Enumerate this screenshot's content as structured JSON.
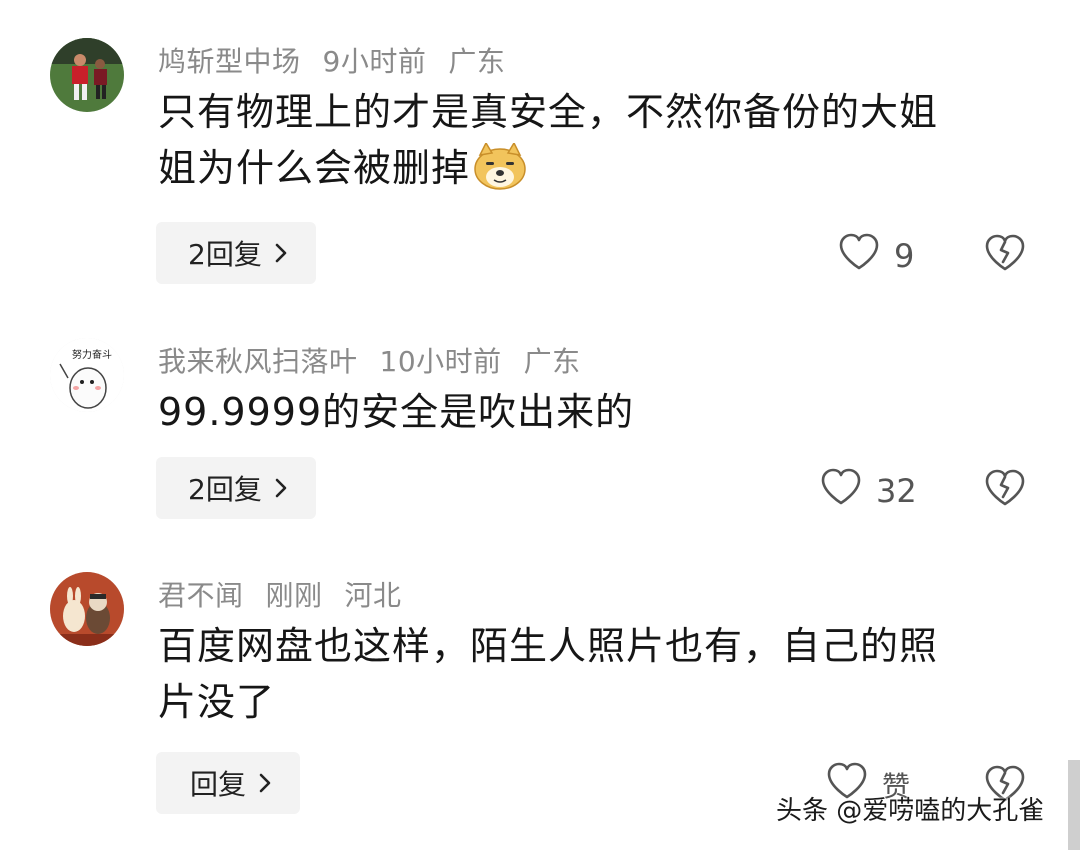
{
  "comments": [
    {
      "username": "鸠斩型中场",
      "time": "9小时前",
      "location": "广东",
      "text_line1": "只有物理上的才是真安全，不然你备份的大姐",
      "text_line2": "姐为什么会被删掉",
      "emoji": "doge-icon",
      "reply_label": "2回复",
      "likes": "9"
    },
    {
      "username": "我来秋风扫落叶",
      "time": "10小时前",
      "location": "广东",
      "text": "99.9999的安全是吹出来的",
      "avatar_text": "努力奋斗",
      "reply_label": "2回复",
      "likes": "32"
    },
    {
      "username": "君不闻",
      "time": "刚刚",
      "location": "河北",
      "text_line1": "百度网盘也这样，陌生人照片也有，自己的照",
      "text_line2": "片没了",
      "reply_label": "回复",
      "likes": "赞"
    }
  ],
  "watermark": "头条 @爱唠嗑的大孔雀",
  "colors": {
    "meta": "#8a8a8a",
    "text": "#161616",
    "reply_bg": "#f3f3f3"
  }
}
